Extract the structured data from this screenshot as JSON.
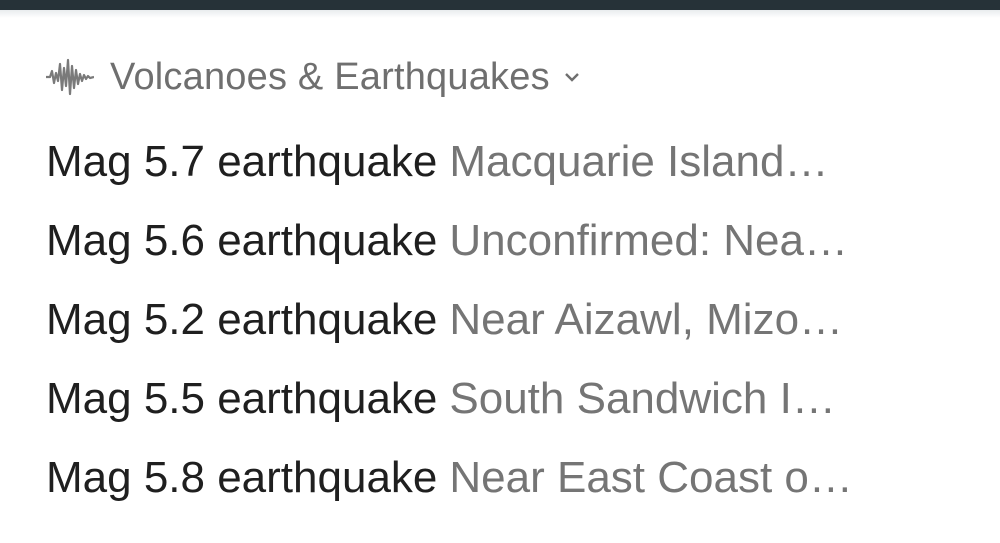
{
  "header": {
    "icon": "seismograph-wave-icon",
    "title": "Volcanoes & Earthquakes",
    "dropdown_icon": "chevron-down-icon"
  },
  "quakes": [
    {
      "title": "Mag 5.7 earthquake",
      "location": "Macquarie Island…"
    },
    {
      "title": "Mag 5.6 earthquake",
      "location": "Unconfirmed: Nea…"
    },
    {
      "title": "Mag 5.2 earthquake",
      "location": "Near Aizawl, Mizo…"
    },
    {
      "title": "Mag 5.5 earthquake",
      "location": "South Sandwich I…"
    },
    {
      "title": "Mag 5.8 earthquake",
      "location": "Near East Coast o…"
    }
  ],
  "colors": {
    "top_bar": "#263238",
    "title_text": "#1f1f1f",
    "secondary_text": "#757575",
    "header_text": "#6f6f6f"
  }
}
